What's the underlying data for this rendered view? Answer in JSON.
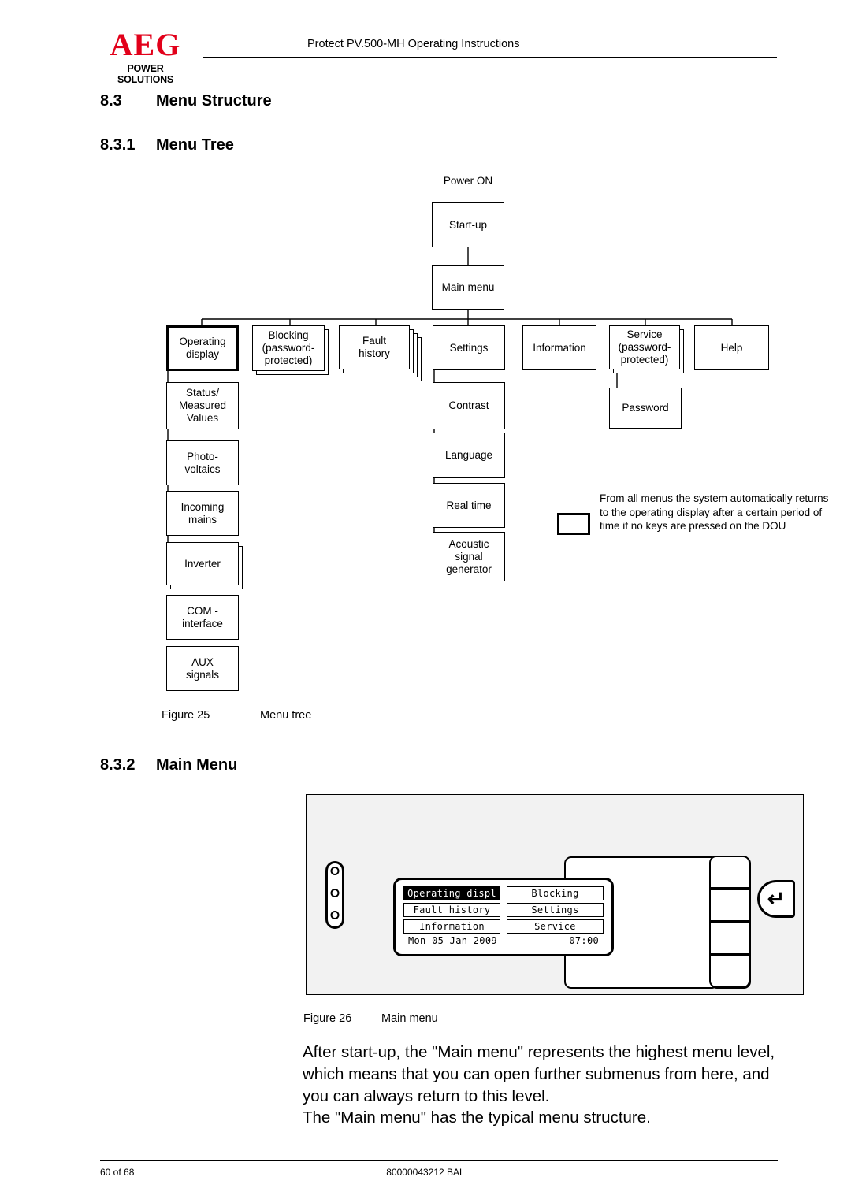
{
  "header": {
    "logo_main": "AEG",
    "logo_sub": "POWER SOLUTIONS",
    "title": "Protect PV.500-MH Operating Instructions"
  },
  "headings": {
    "s83_num": "8.3",
    "s83_text": "Menu Structure",
    "s831_num": "8.3.1",
    "s831_text": "Menu Tree",
    "s832_num": "8.3.2",
    "s832_text": "Main Menu"
  },
  "tree": {
    "power_on": "Power ON",
    "start_up": "Start-up",
    "main_menu": "Main menu",
    "level1": {
      "operating_display": "Operating\ndisplay",
      "blocking": "Blocking\n(password-\nprotected)",
      "fault_history": "Fault\nhistory",
      "settings": "Settings",
      "information": "Information",
      "service": "Service\n(password-\nprotected)",
      "help": "Help"
    },
    "operating_children": [
      "Status/\nMeasured\nValues",
      "Photo-\nvoltaics",
      "Incoming\nmains",
      "Inverter",
      "COM -\ninterface",
      "AUX\nsignals"
    ],
    "settings_children": [
      "Contrast",
      "Language",
      "Real time",
      "Acoustic\nsignal\ngenerator"
    ],
    "service_children": [
      "Password"
    ],
    "note": "From all menus the system automatically returns to the operating display after a certain period of time if no keys are pressed on the DOU"
  },
  "figures": {
    "fig25_label": "Figure 25",
    "fig25_text": "Menu tree",
    "fig26_label": "Figure 26",
    "fig26_text": "Main menu"
  },
  "dou": {
    "lcd": {
      "items": [
        {
          "label": "Operating displ",
          "selected": true
        },
        {
          "label": "Blocking",
          "selected": false
        },
        {
          "label": "Fault history",
          "selected": false
        },
        {
          "label": "Settings",
          "selected": false
        },
        {
          "label": "Information",
          "selected": false
        },
        {
          "label": "Service",
          "selected": false
        }
      ],
      "date": "Mon 05 Jan 2009",
      "time": "07:00"
    },
    "enter_glyph": "↵"
  },
  "body": {
    "para_1": "After start-up, the \"Main menu\" represents the highest menu level, which means that you can open further submenus from here, and you can always return to this level.",
    "para_2": "The \"Main menu\" has the typical menu structure."
  },
  "footer": {
    "page": "60 of 68",
    "doc_id": "80000043212 BAL"
  },
  "colors": {
    "brand_red": "#e2001a",
    "ink": "#000000",
    "panel_fill": "#f2f2f2"
  }
}
